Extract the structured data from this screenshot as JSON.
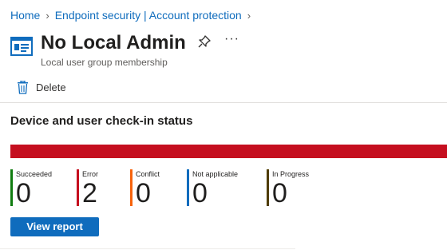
{
  "breadcrumb": {
    "items": [
      "Home",
      "Endpoint security | Account protection"
    ]
  },
  "header": {
    "title": "No Local Admin",
    "subtitle": "Local user group membership",
    "more": "···"
  },
  "toolbar": {
    "delete_label": "Delete"
  },
  "section": {
    "title": "Device and user check-in status"
  },
  "status_bar": {
    "color": "#c50f1f",
    "error_fraction": 1.0
  },
  "stats": [
    {
      "label": "Succeeded",
      "value": "0",
      "color": "#107c10"
    },
    {
      "label": "Error",
      "value": "2",
      "color": "#c50f1f"
    },
    {
      "label": "Conflict",
      "value": "0",
      "color": "#f7630c"
    },
    {
      "label": "Not applicable",
      "value": "0",
      "color": "#0f6cbd"
    },
    {
      "label": "In Progress",
      "value": "0",
      "color": "#4f3d00"
    }
  ],
  "actions": {
    "view_report_label": "View report"
  }
}
